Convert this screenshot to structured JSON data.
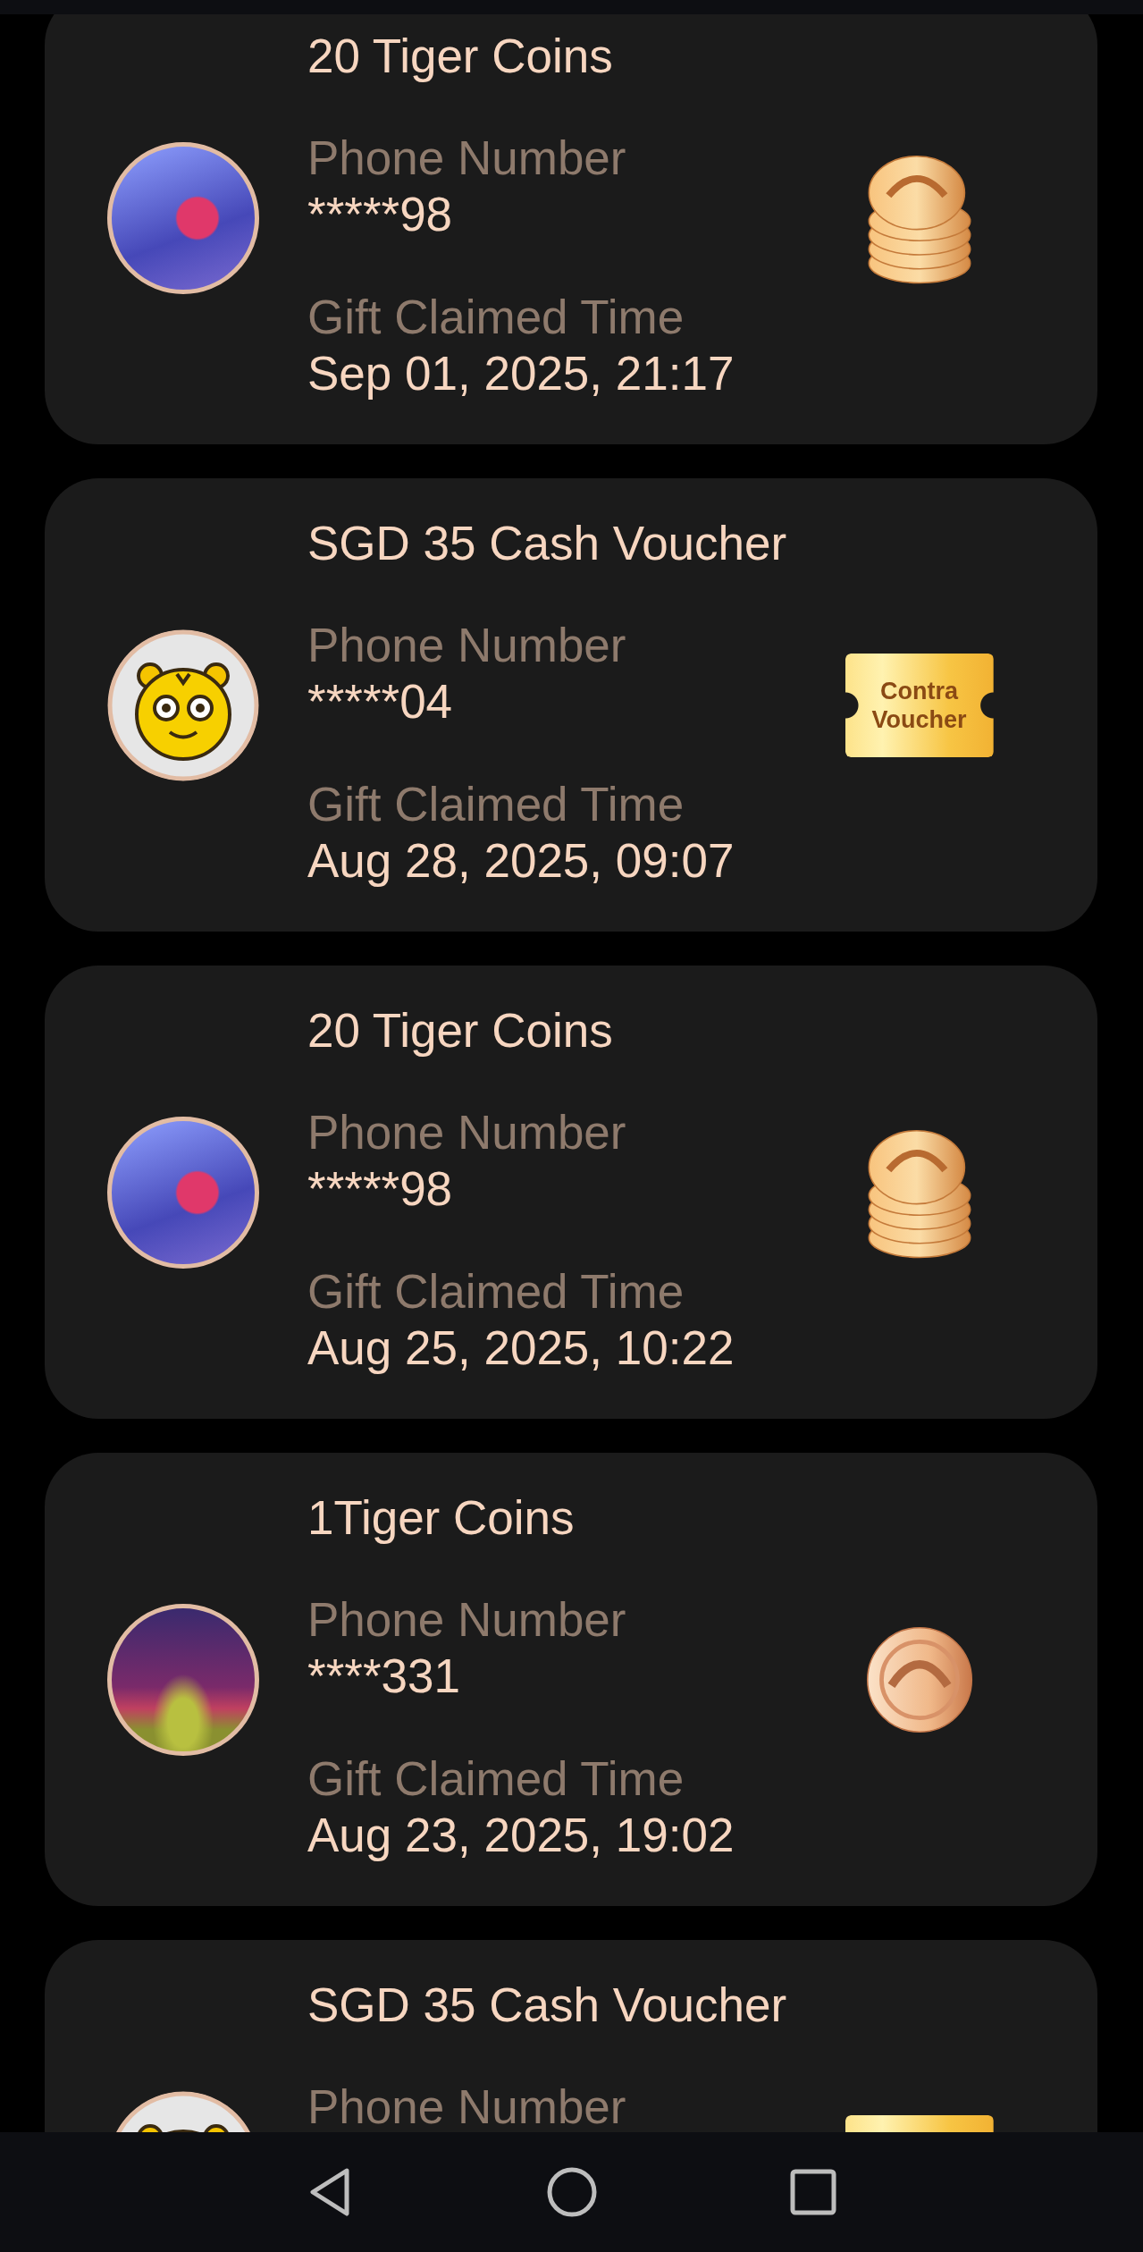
{
  "records": [
    {
      "title": "20 Tiger Coins",
      "avatar": {
        "kind": "photo"
      },
      "phone_label": "Phone Number",
      "phone": "*****98",
      "time_label": "Gift Claimed Time",
      "time": "Sep 01, 2025, 21:17",
      "gift": {
        "kind": "coin-stack"
      }
    },
    {
      "title": "SGD 35 Cash Voucher",
      "avatar": {
        "kind": "mascot"
      },
      "phone_label": "Phone Number",
      "phone": "*****04",
      "time_label": "Gift Claimed Time",
      "time": "Aug 28, 2025, 09:07",
      "gift": {
        "kind": "voucher",
        "lines": [
          "Contra",
          "Voucher"
        ]
      }
    },
    {
      "title": "20 Tiger Coins",
      "avatar": {
        "kind": "photo"
      },
      "phone_label": "Phone Number",
      "phone": "*****98",
      "time_label": "Gift Claimed Time",
      "time": "Aug 25, 2025, 10:22",
      "gift": {
        "kind": "coin-stack"
      }
    },
    {
      "title": "1Tiger Coins",
      "avatar": {
        "kind": "landscape"
      },
      "phone_label": "Phone Number",
      "phone": "****331",
      "time_label": "Gift Claimed Time",
      "time": "Aug 23, 2025, 19:02",
      "gift": {
        "kind": "coin"
      }
    },
    {
      "title": "SGD 35 Cash Voucher",
      "avatar": {
        "kind": "mascot"
      },
      "phone_label": "Phone Number",
      "gift": {
        "kind": "voucher"
      }
    }
  ]
}
